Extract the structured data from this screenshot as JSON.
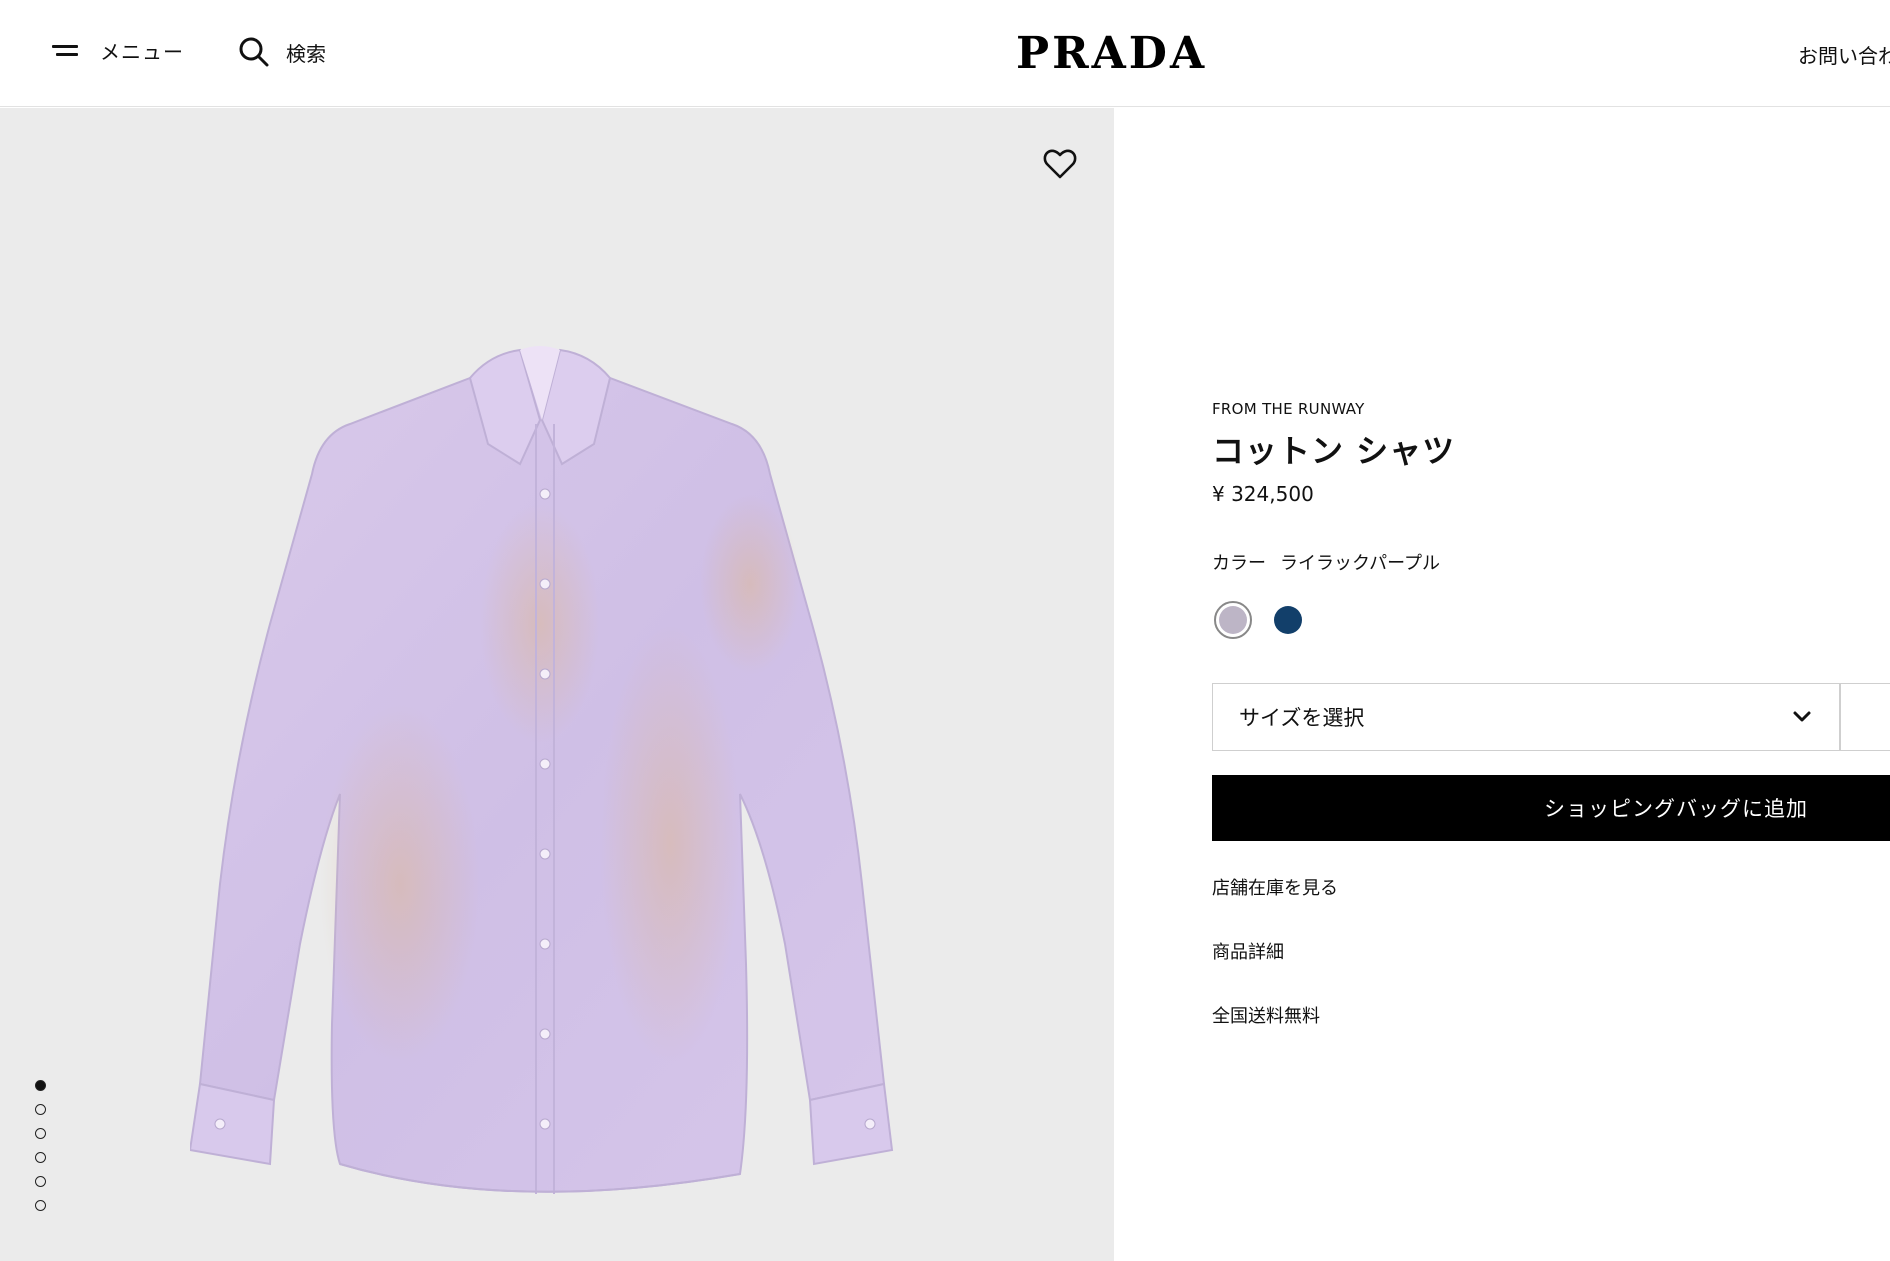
{
  "header": {
    "menu_label": "メニュー",
    "search_label": "検索",
    "logo": "PRADA",
    "contact_label": "お問い合わ"
  },
  "gallery": {
    "image_description_icon": "shirt-image",
    "image_count": 6,
    "active_index": 0,
    "background_color": "#ebebeb"
  },
  "product": {
    "tag": "FROM THE RUNWAY",
    "title": "コットン シャツ",
    "price": "¥ 324,500",
    "color_label": "カラー",
    "color_value": "ライラックパープル",
    "colors": [
      {
        "name": "lilac",
        "hex": "#bdb5c6",
        "selected": true
      },
      {
        "name": "navy",
        "hex": "#123f6a",
        "selected": false
      }
    ],
    "size_placeholder": "サイズを選択",
    "add_to_bag_label": "ショッピングバッグに追加",
    "links": [
      "店舗在庫を見る",
      "商品詳細",
      "全国送料無料"
    ]
  }
}
